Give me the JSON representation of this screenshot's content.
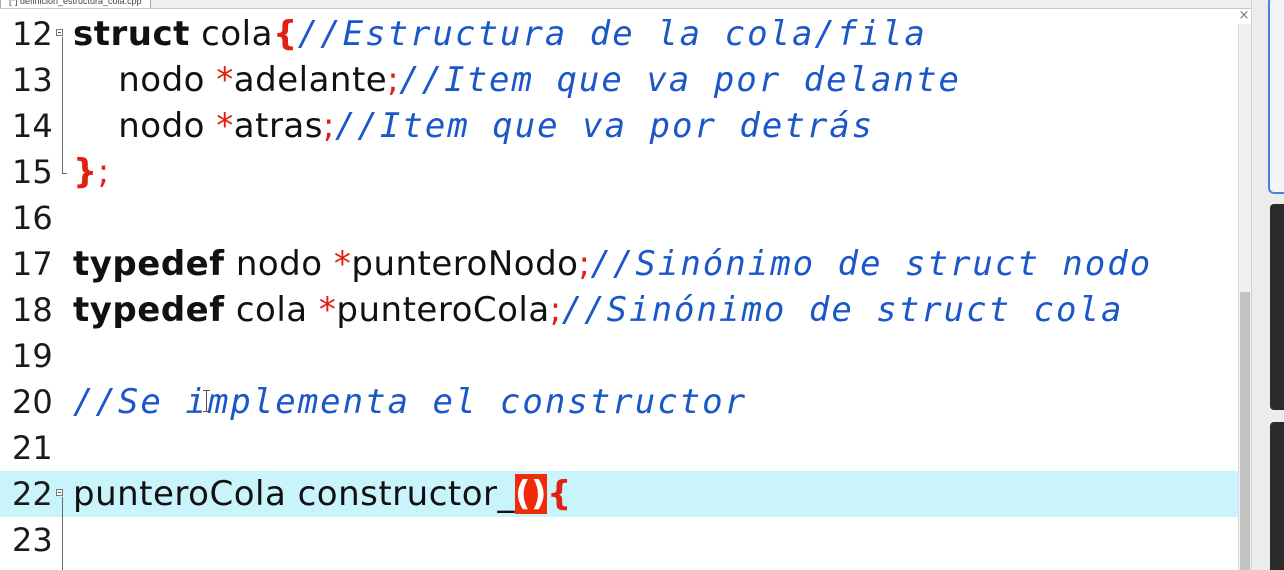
{
  "tab": {
    "label": "[*] definicion_estructura_cola.cpp",
    "close_label": "×"
  },
  "editor": {
    "current_line": 22,
    "lines": [
      {
        "number": "12",
        "tokens": [
          {
            "t": "struct",
            "k": "kw"
          },
          {
            "t": " cola",
            "k": "id"
          },
          {
            "t": "{",
            "k": "br"
          },
          {
            "t": "//Estructura de la cola/fila",
            "k": "cm"
          }
        ]
      },
      {
        "number": "13",
        "tokens": [
          {
            "t": "    nodo ",
            "k": "id"
          },
          {
            "t": "*",
            "k": "op"
          },
          {
            "t": "adelante",
            "k": "id"
          },
          {
            "t": ";",
            "k": "op"
          },
          {
            "t": "//Item que va por delante",
            "k": "cm"
          }
        ]
      },
      {
        "number": "14",
        "tokens": [
          {
            "t": "    nodo ",
            "k": "id"
          },
          {
            "t": "*",
            "k": "op"
          },
          {
            "t": "atras",
            "k": "id"
          },
          {
            "t": ";",
            "k": "op"
          },
          {
            "t": "//Item que va por detrás",
            "k": "cm"
          }
        ]
      },
      {
        "number": "15",
        "tokens": [
          {
            "t": "}",
            "k": "br"
          },
          {
            "t": ";",
            "k": "op"
          }
        ]
      },
      {
        "number": "16",
        "tokens": []
      },
      {
        "number": "17",
        "tokens": [
          {
            "t": "typedef",
            "k": "kw"
          },
          {
            "t": " nodo ",
            "k": "id"
          },
          {
            "t": "*",
            "k": "op"
          },
          {
            "t": "punteroNodo",
            "k": "id"
          },
          {
            "t": ";",
            "k": "op"
          },
          {
            "t": "//Sinónimo de struct nodo",
            "k": "cm"
          }
        ]
      },
      {
        "number": "18",
        "tokens": [
          {
            "t": "typedef",
            "k": "kw"
          },
          {
            "t": " cola ",
            "k": "id"
          },
          {
            "t": "*",
            "k": "op"
          },
          {
            "t": "punteroCola",
            "k": "id"
          },
          {
            "t": ";",
            "k": "op"
          },
          {
            "t": "//Sinónimo de struct cola",
            "k": "cm"
          }
        ]
      },
      {
        "number": "19",
        "tokens": []
      },
      {
        "number": "20",
        "tokens": [
          {
            "t": "//Se implementa el constructor",
            "k": "cm"
          }
        ]
      },
      {
        "number": "21",
        "tokens": []
      },
      {
        "number": "22",
        "tokens": [
          {
            "t": "punteroCola constructor_",
            "k": "id"
          },
          {
            "t": "()",
            "k": "hl"
          },
          {
            "t": "{",
            "k": "br"
          }
        ]
      },
      {
        "number": "23",
        "tokens": []
      }
    ]
  },
  "colors": {
    "keyword": "#111111",
    "operator": "#e02010",
    "comment": "#1a57c8",
    "current_line_bg": "#c9f4fb",
    "bracket_match_bg": "#ef2b0a"
  },
  "icons": {
    "fold_marker": "fold-minus-icon",
    "text_cursor": "ibeam-cursor-icon",
    "close": "close-icon"
  }
}
